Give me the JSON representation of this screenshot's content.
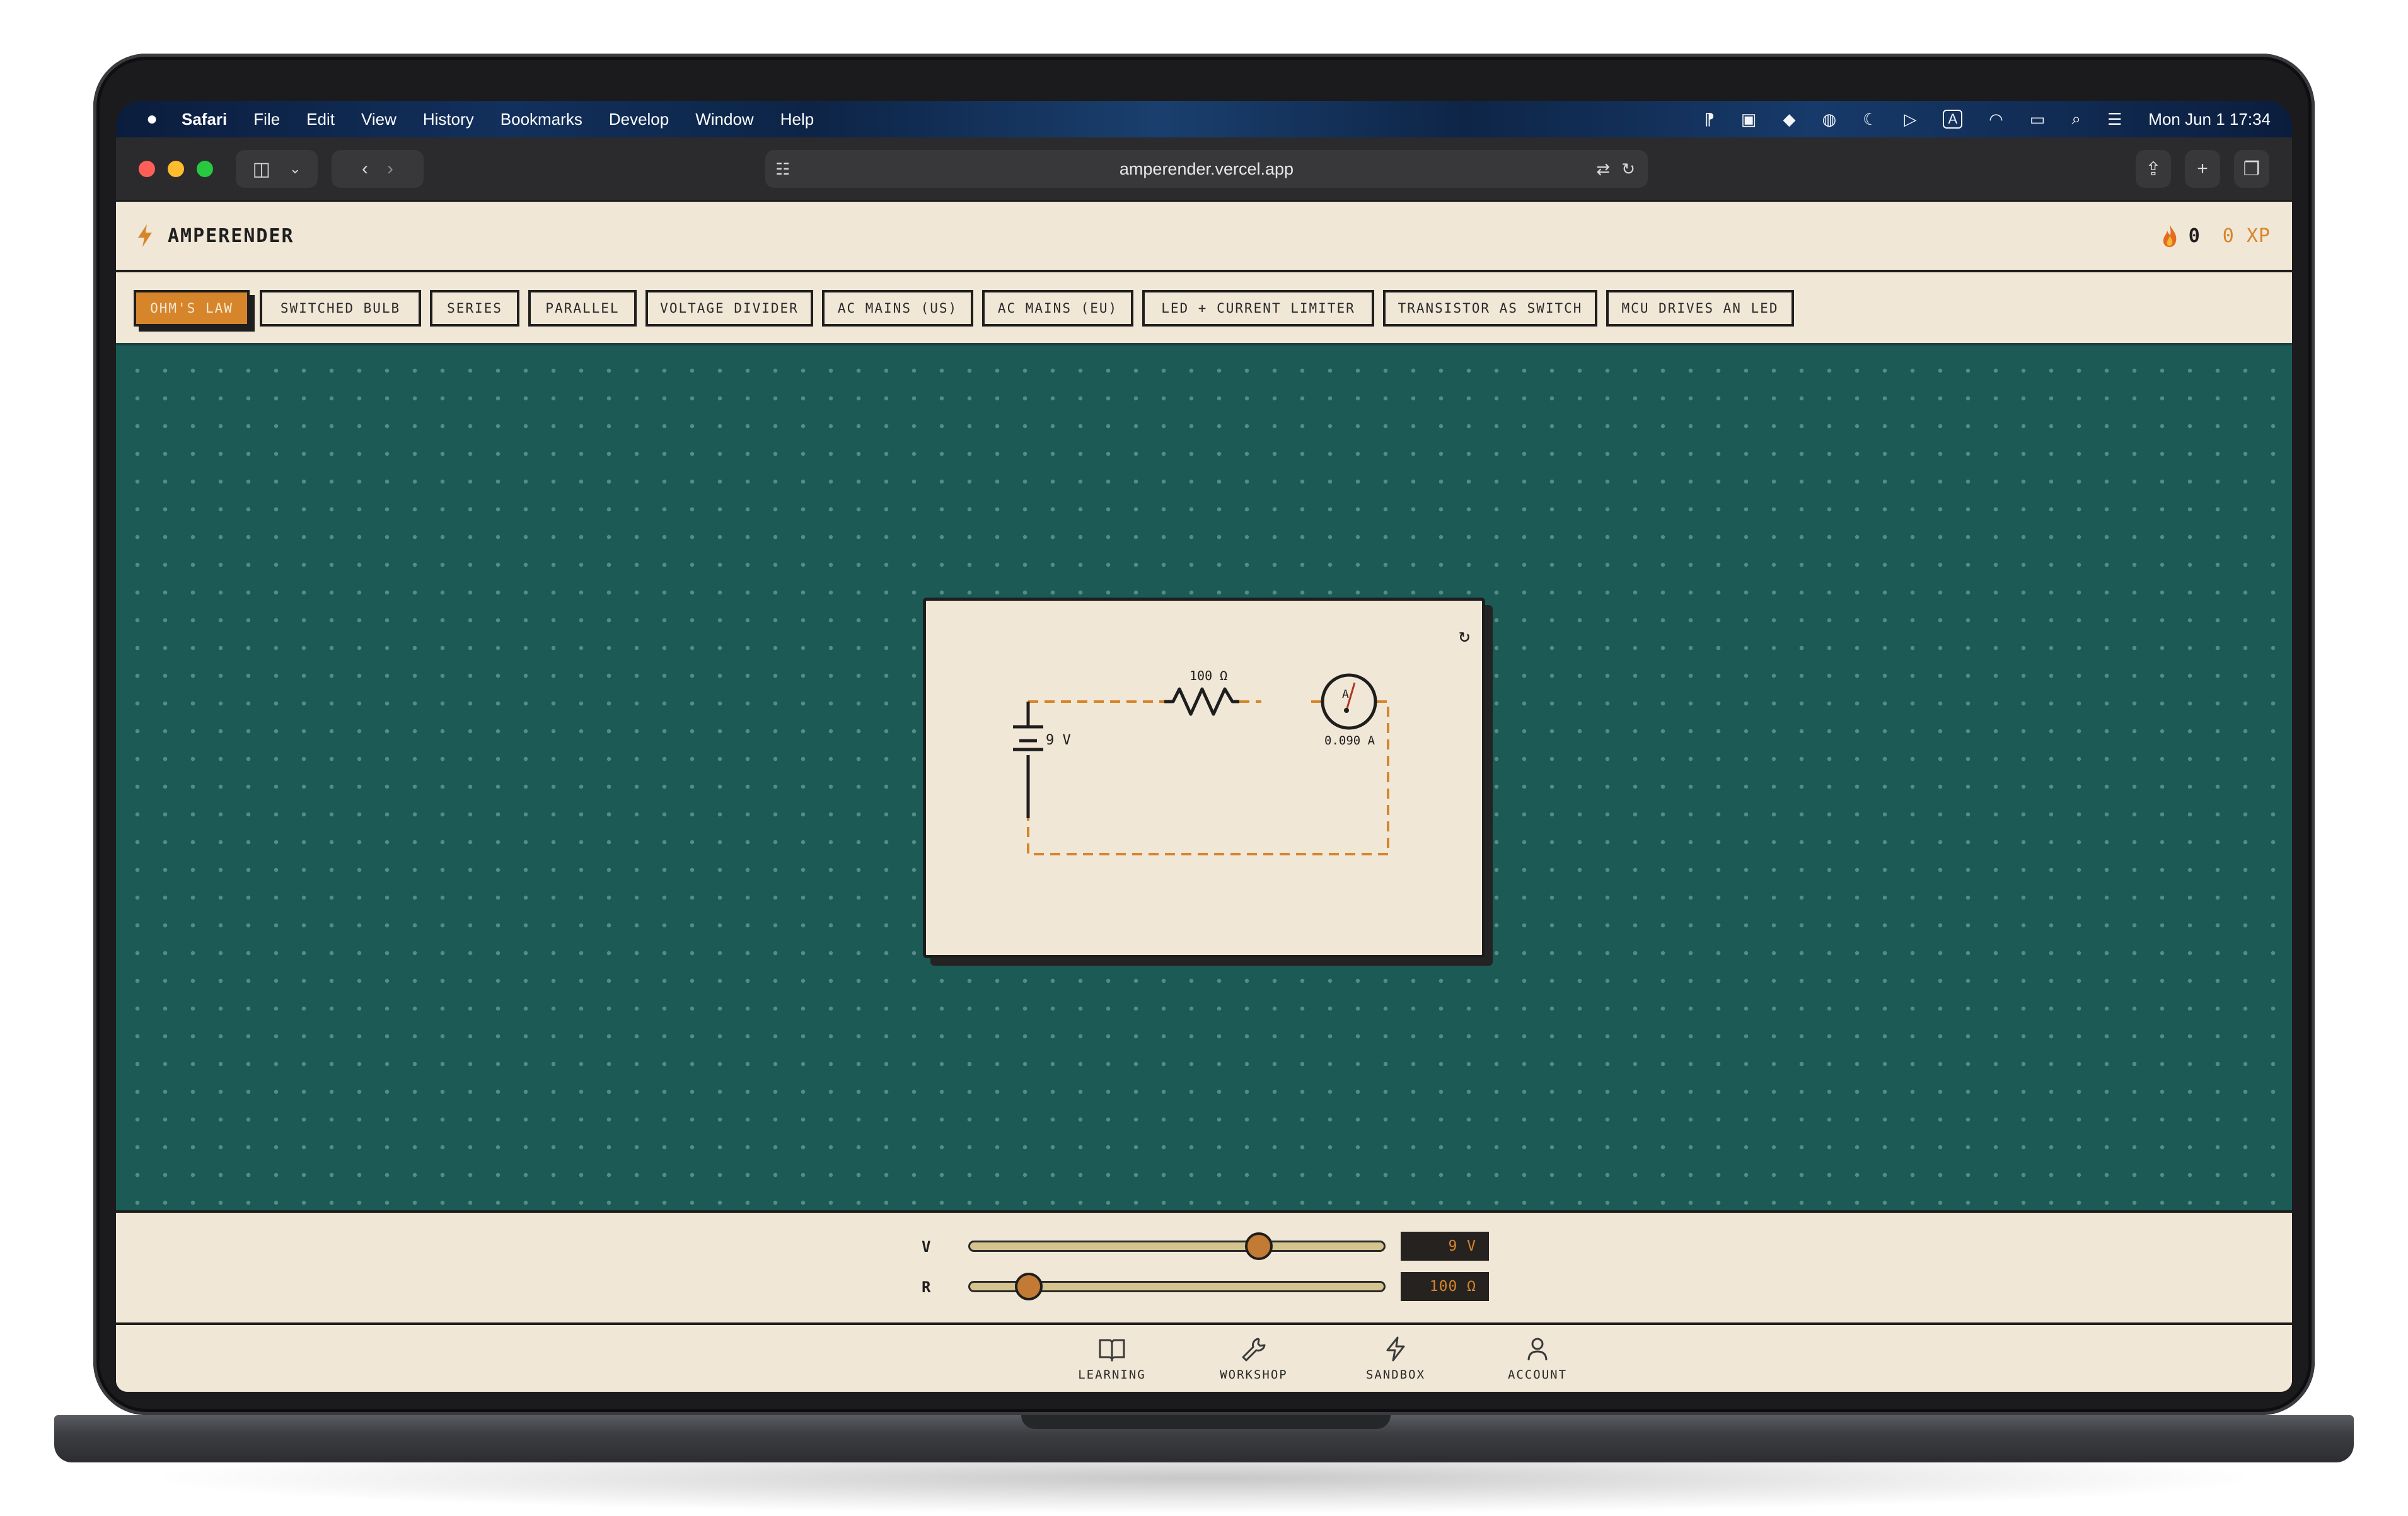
{
  "menubar": {
    "items": [
      "Safari",
      "File",
      "Edit",
      "View",
      "History",
      "Bookmarks",
      "Develop",
      "Window",
      "Help"
    ],
    "clock": "Mon Jun 1  17:34",
    "status_icons": [
      "focus-icon",
      "teams-icon",
      "cursor-icon",
      "accessibility-icon",
      "moon-icon",
      "play-icon",
      "input-source-icon",
      "wifi-icon",
      "battery-icon",
      "search-icon",
      "control-center-icon"
    ],
    "input_source_label": "A"
  },
  "browser": {
    "url": "amperender.vercel.app"
  },
  "app": {
    "name": "AMPERENDER",
    "streak": "0",
    "xp": "0 XP",
    "accent_color": "#d6852b",
    "board_color": "#1c5a56"
  },
  "tabs": [
    {
      "label": "OHM'S LAW",
      "active": true
    },
    {
      "label": "SWITCHED BULB",
      "active": false
    },
    {
      "label": "SERIES",
      "active": false
    },
    {
      "label": "PARALLEL",
      "active": false
    },
    {
      "label": "VOLTAGE DIVIDER",
      "active": false
    },
    {
      "label": "AC MAINS (US)",
      "active": false
    },
    {
      "label": "AC MAINS (EU)",
      "active": false
    },
    {
      "label": "LED + CURRENT LIMITER",
      "active": false
    },
    {
      "label": "TRANSISTOR AS SWITCH",
      "active": false
    },
    {
      "label": "MCU DRIVES AN LED",
      "active": false
    }
  ],
  "circuit": {
    "resistor_label": "100 Ω",
    "battery_label": "9 V",
    "ammeter_symbol": "A",
    "ammeter_reading": "0.090 A",
    "reset_symbol": "↻"
  },
  "controls": {
    "voltage": {
      "label": "V",
      "readout": "9 V",
      "fraction": 0.71
    },
    "resistance": {
      "label": "R",
      "readout": "100 Ω",
      "fraction": 0.12
    }
  },
  "bottom_nav": [
    {
      "label": "LEARNING",
      "icon": "book-icon"
    },
    {
      "label": "WORKSHOP",
      "icon": "wrench-icon"
    },
    {
      "label": "SANDBOX",
      "icon": "bolt-icon"
    },
    {
      "label": "ACCOUNT",
      "icon": "person-icon"
    }
  ]
}
